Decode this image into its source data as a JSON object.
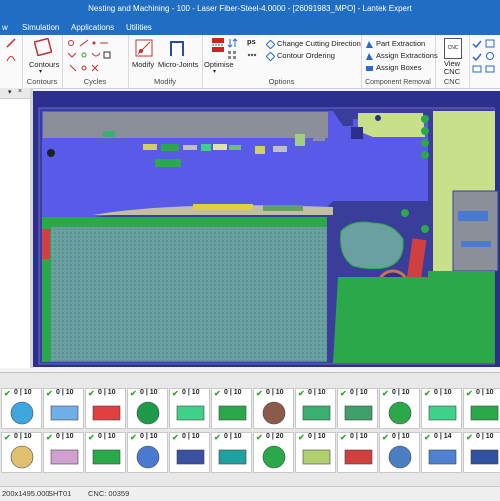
{
  "title": "Nesting and Machining - 100 - Laser Fiber-Steel-4.0000 - [26091983_MPO] - Lantek Expert",
  "menu": [
    "w",
    "Simulation",
    "Applications",
    "Utilities"
  ],
  "ribbon": {
    "contours_btn": "Contours",
    "contours_group": "Contours",
    "cycles_group": "Cycles",
    "modify_btn": "Modify",
    "microjoints_btn": "Micro-Joints",
    "modify_group": "Modify",
    "optimise_btn": "Optimise",
    "ps_text": "ps",
    "change_direction": "Change Cutting Direction",
    "contour_ordering": "Contour Ordering",
    "options_group": "Options",
    "part_extraction": "Part Extraction",
    "assign_extractions": "Assign Extractions",
    "assign_boxes": "Assign Boxes",
    "component_removal_group": "Component Removal",
    "view_cnc": "View CNC",
    "cnc_group": "CNC",
    "cnc_icon_text": "CNC"
  },
  "parts_row1": [
    {
      "count": "0 | 10",
      "color": "#3fa6e0"
    },
    {
      "count": "0 | 10",
      "color": "#6fb0e8"
    },
    {
      "count": "0 | 10",
      "color": "#e04040"
    },
    {
      "count": "0 | 10",
      "color": "#1f9a4a"
    },
    {
      "count": "0 | 10",
      "color": "#3fd08a"
    },
    {
      "count": "0 | 10",
      "color": "#2aa84a"
    },
    {
      "count": "0 | 10",
      "color": "#8a5a4a"
    },
    {
      "count": "0 | 10",
      "color": "#3ab070"
    },
    {
      "count": "0 | 10",
      "color": "#3fa06a"
    },
    {
      "count": "0 | 10",
      "color": "#2aa84a"
    },
    {
      "count": "0 | 10",
      "color": "#3fd08a"
    },
    {
      "count": "0 | 10",
      "color": "#2aa84a"
    }
  ],
  "parts_row2": [
    {
      "count": "0 | 10",
      "color": "#e0c070"
    },
    {
      "count": "0 | 10",
      "color": "#d0a0d0"
    },
    {
      "count": "0 | 10",
      "color": "#2aa84a"
    },
    {
      "count": "0 | 10",
      "color": "#4a7ad0"
    },
    {
      "count": "0 | 10",
      "color": "#3a50a0"
    },
    {
      "count": "0 | 10",
      "color": "#20a0a0"
    },
    {
      "count": "0 | 20",
      "color": "#2aa84a"
    },
    {
      "count": "0 | 10",
      "color": "#b0d070"
    },
    {
      "count": "0 | 10",
      "color": "#d04040"
    },
    {
      "count": "0 | 10",
      "color": "#4a80c0"
    },
    {
      "count": "0 | 14",
      "color": "#5080d0"
    },
    {
      "count": "0 | 10",
      "color": "#3050a0"
    }
  ],
  "status": {
    "size": "200x1495.000",
    "sheet": "SHT01",
    "cnc": "CNC: 00359"
  }
}
